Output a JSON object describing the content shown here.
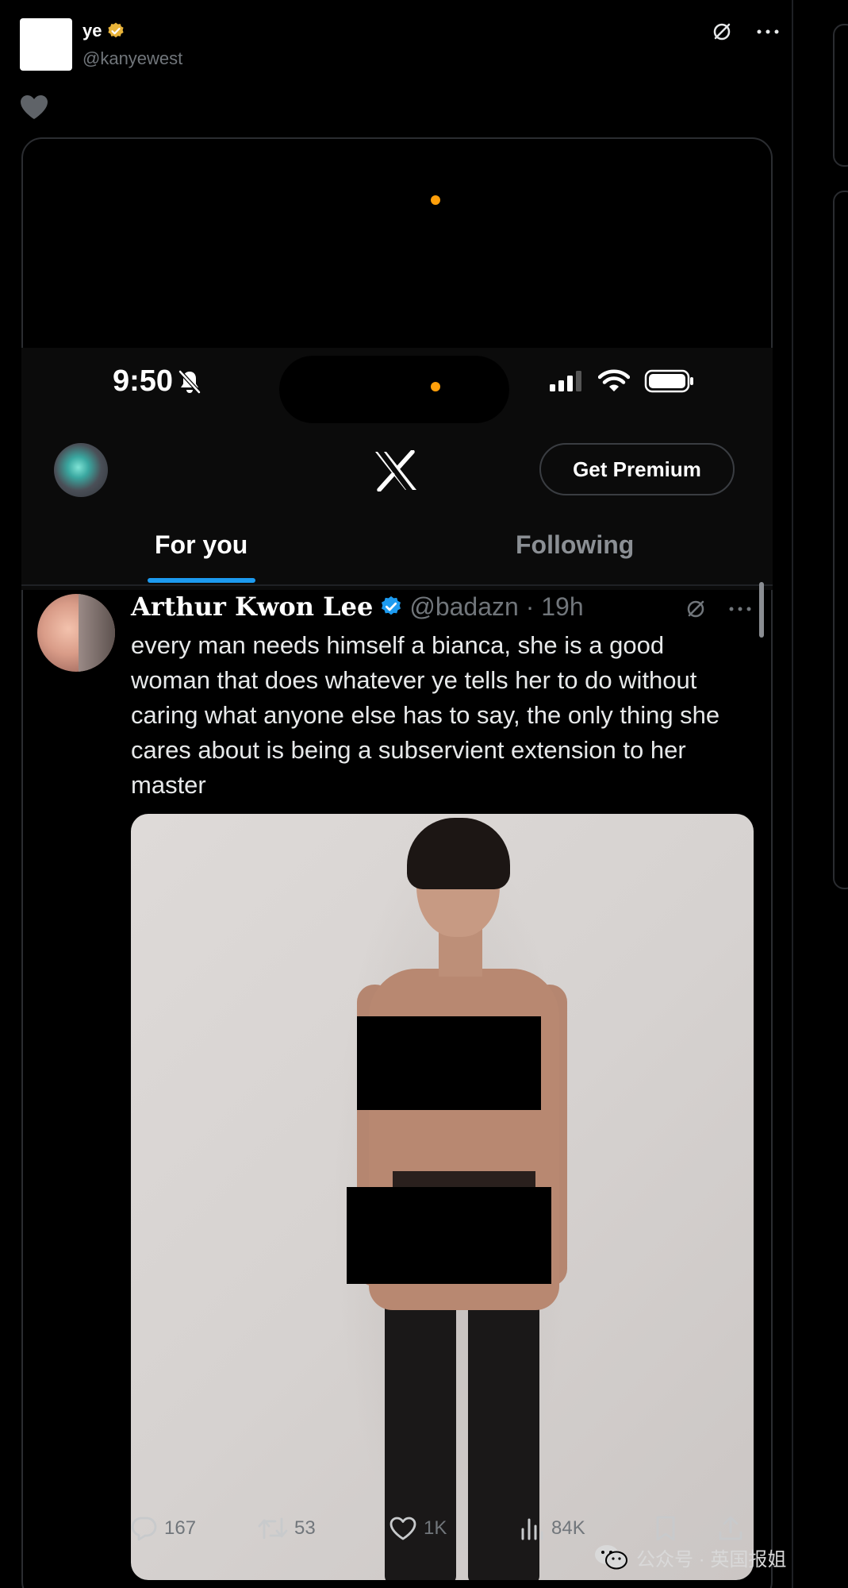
{
  "outer_tweet": {
    "name": "ye",
    "handle": "@kanyewest"
  },
  "phone": {
    "time": "9:50"
  },
  "x_header": {
    "premium_label": "Get Premium",
    "tabs": [
      {
        "label": "For you",
        "active": true
      },
      {
        "label": "Following",
        "active": false
      }
    ]
  },
  "inner_tweet": {
    "name": "Arthur Kwon Lee",
    "handle_time": "@badazn · 19h",
    "text": "every man needs himself a bianca, she is a good woman that does whatever ye tells her to do without caring what anyone else has to say, the only thing she cares about is being a subservient extension to her master",
    "stats": {
      "replies": "167",
      "reposts": "53",
      "likes": "1K",
      "views": "84K"
    }
  },
  "watermark": {
    "text": "公众号 · 英国报姐"
  },
  "colors": {
    "accent": "#1d9bf0",
    "verified_gold": "#e8b339",
    "muted": "#71767b",
    "orange_indicator": "#ff9f0a"
  }
}
